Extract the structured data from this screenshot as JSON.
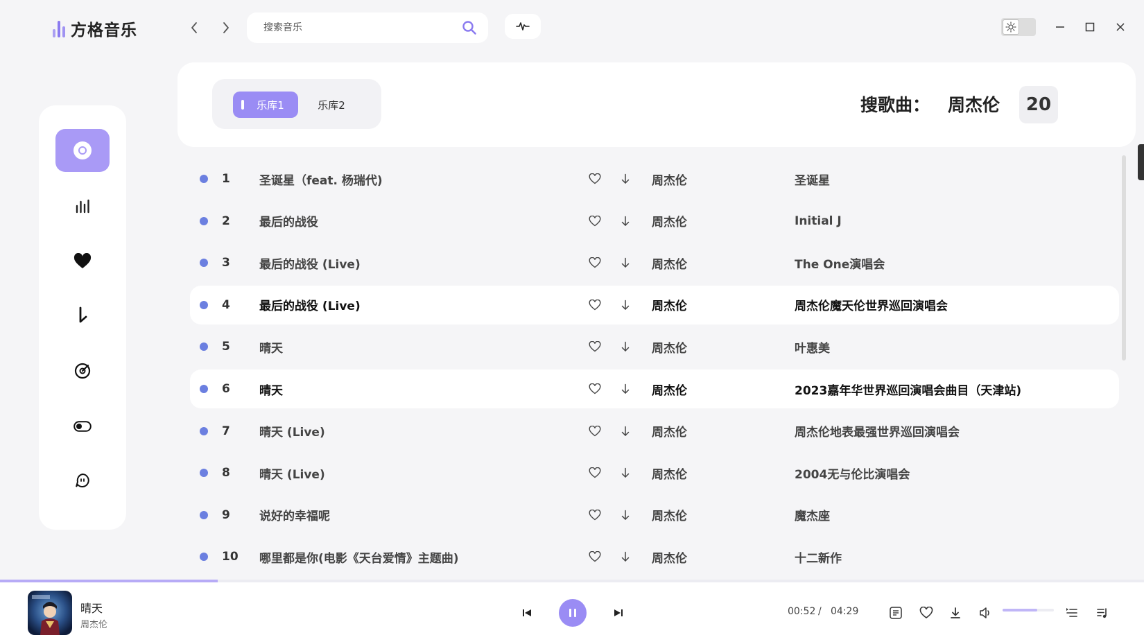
{
  "app": {
    "title": "方格音乐"
  },
  "search": {
    "placeholder": "搜索音乐",
    "value": ""
  },
  "sidebar": {
    "items": [
      {
        "id": "disc",
        "icon": "disc-icon",
        "active": true
      },
      {
        "id": "charts",
        "icon": "bar-chart-icon",
        "active": false
      },
      {
        "id": "favorites",
        "icon": "heart-icon",
        "active": false
      },
      {
        "id": "downloads",
        "icon": "download-arrow-icon",
        "active": false
      },
      {
        "id": "radar",
        "icon": "radar-icon",
        "active": false
      },
      {
        "id": "toggle",
        "icon": "toggle-icon",
        "active": false
      },
      {
        "id": "chat",
        "icon": "chat-bubble-icon",
        "active": false
      }
    ]
  },
  "libraries": {
    "tabs": [
      "乐库1",
      "乐库2"
    ],
    "active": 0
  },
  "summary": {
    "label": "搜歌曲：",
    "query": "周杰伦",
    "count": "20"
  },
  "songs": [
    {
      "index": "1",
      "title": "圣诞星（feat. 杨瑞代)",
      "artist": "周杰伦",
      "album": "圣诞星",
      "highlight": false
    },
    {
      "index": "2",
      "title": "最后的战役",
      "artist": "周杰伦",
      "album": "Initial J",
      "highlight": false
    },
    {
      "index": "3",
      "title": "最后的战役 (Live)",
      "artist": "周杰伦",
      "album": "The One演唱会",
      "highlight": false
    },
    {
      "index": "4",
      "title": "最后的战役 (Live)",
      "artist": "周杰伦",
      "album": "周杰伦魔天伦世界巡回演唱会",
      "highlight": true
    },
    {
      "index": "5",
      "title": "晴天",
      "artist": "周杰伦",
      "album": "叶惠美",
      "highlight": false
    },
    {
      "index": "6",
      "title": "晴天",
      "artist": "周杰伦",
      "album": "2023嘉年华世界巡回演唱会曲目（天津站)",
      "highlight": true
    },
    {
      "index": "7",
      "title": "晴天 (Live)",
      "artist": "周杰伦",
      "album": "周杰伦地表最强世界巡回演唱会",
      "highlight": false
    },
    {
      "index": "8",
      "title": "晴天 (Live)",
      "artist": "周杰伦",
      "album": "2004无与伦比演唱会",
      "highlight": false
    },
    {
      "index": "9",
      "title": "说好的幸福呢",
      "artist": "周杰伦",
      "album": "魔杰座",
      "highlight": false
    },
    {
      "index": "10",
      "title": "哪里都是你(电影《天台爱情》主题曲)",
      "artist": "周杰伦",
      "album": "十二新作",
      "highlight": false
    }
  ],
  "player": {
    "title": "晴天",
    "artist": "周杰伦",
    "current_time": "00:52",
    "separator": "/",
    "total_time": "04:29",
    "progress": 0.19,
    "volume": 0.68,
    "state": "playing"
  },
  "colors": {
    "accent": "#9a8cf4",
    "dot": "#6b7fe0",
    "background": "#f5f5f7"
  }
}
